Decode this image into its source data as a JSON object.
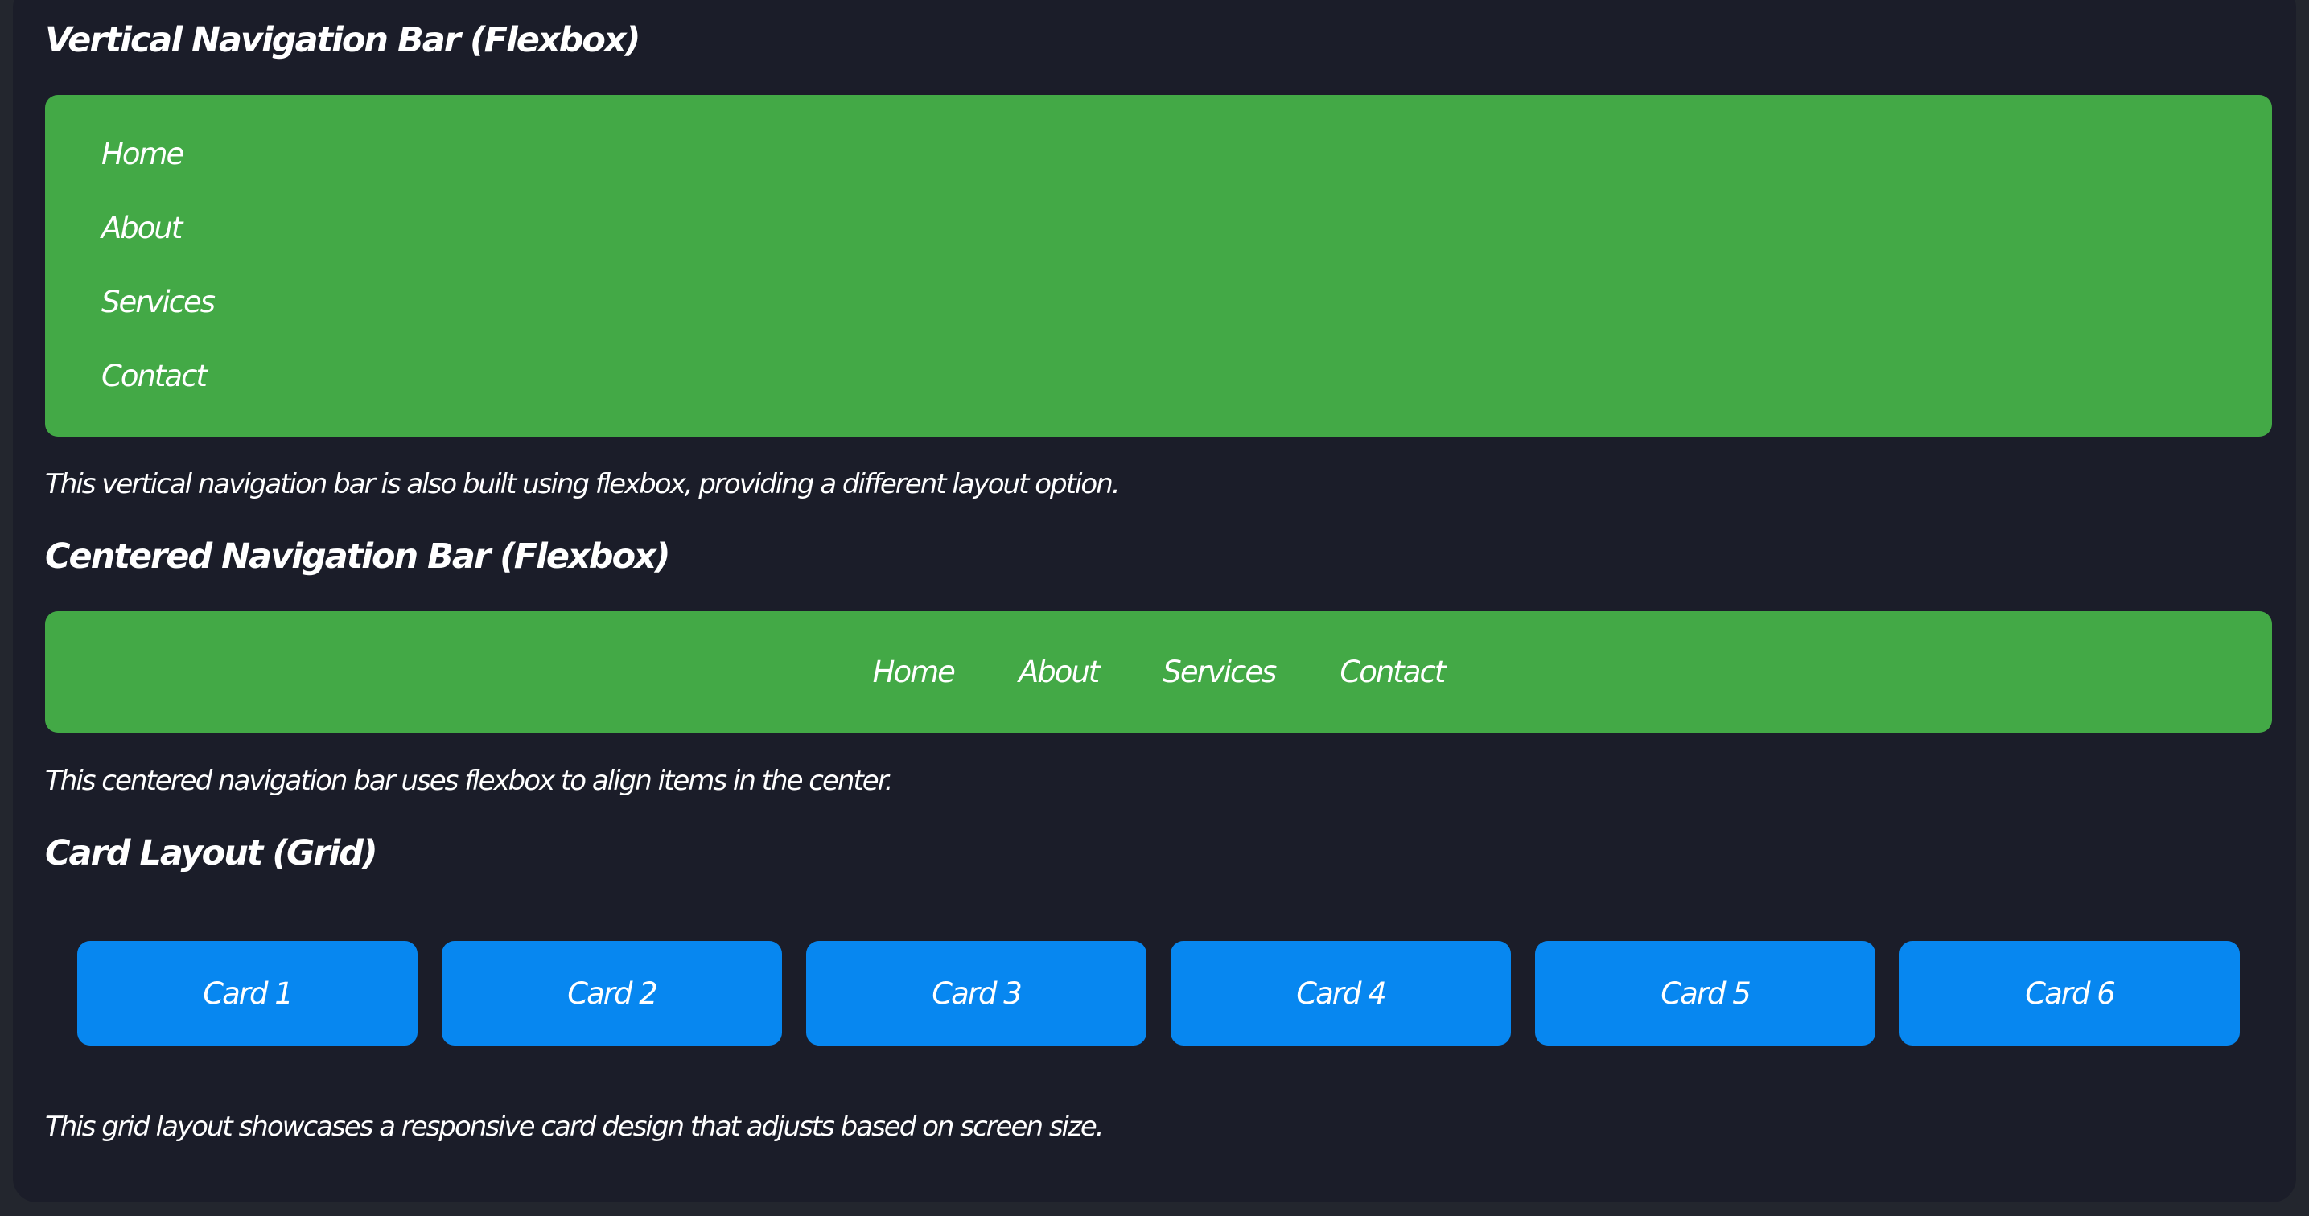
{
  "vertical_section": {
    "heading": "Vertical Navigation Bar (Flexbox)",
    "nav_items": [
      "Home",
      "About",
      "Services",
      "Contact"
    ],
    "description": "This vertical navigation bar is also built using flexbox, providing a different layout option."
  },
  "centered_section": {
    "heading": "Centered Navigation Bar (Flexbox)",
    "nav_items": [
      "Home",
      "About",
      "Services",
      "Contact"
    ],
    "description": "This centered navigation bar uses flexbox to align items in the center."
  },
  "card_section": {
    "heading": "Card Layout (Grid)",
    "cards": [
      "Card 1",
      "Card 2",
      "Card 3",
      "Card 4",
      "Card 5",
      "Card 6"
    ],
    "description": "This grid layout showcases a responsive card design that adjusts based on screen size."
  },
  "colors": {
    "page_background": "#23262e",
    "panel_background": "#1b1d29",
    "nav_background": "#43a946",
    "card_background": "#0787f0",
    "text": "#ffffff"
  }
}
